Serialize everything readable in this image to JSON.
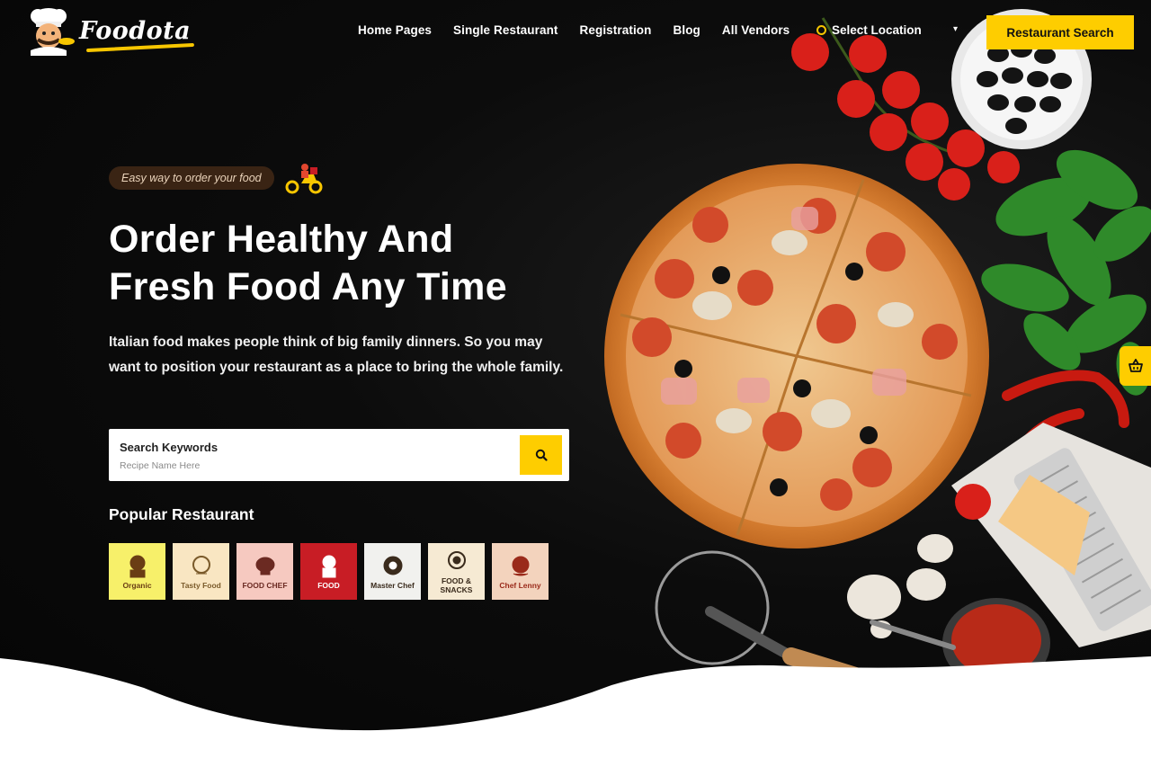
{
  "brand": {
    "name": "Foodota"
  },
  "nav": {
    "items": [
      {
        "label": "Home Pages"
      },
      {
        "label": "Single Restaurant"
      },
      {
        "label": "Registration"
      },
      {
        "label": "Blog"
      },
      {
        "label": "All Vendors"
      }
    ],
    "location_label": "Select Location",
    "cta_label": "Restaurant Search"
  },
  "hero": {
    "badge": "Easy way to order your food",
    "headline_line1": "Order Healthy And",
    "headline_line2": "Fresh Food Any Time",
    "description": "Italian food makes people think of big family dinners. So you may want to position your restaurant as a place to bring the whole family."
  },
  "search": {
    "label": "Search Keywords",
    "placeholder": "Recipe Name Here"
  },
  "popular": {
    "title": "Popular Restaurant",
    "logos": [
      {
        "text": "Organic",
        "bg": "#f7f06a",
        "fg": "#6a3d14"
      },
      {
        "text": "Tasty Food",
        "bg": "#f9e6c2",
        "fg": "#7a5a2a"
      },
      {
        "text": "FOOD CHEF",
        "bg": "#f6c9c0",
        "fg": "#6b2a22"
      },
      {
        "text": "FOOD",
        "bg": "#c81d25",
        "fg": "#ffffff"
      },
      {
        "text": "Master Chef",
        "bg": "#f1f1ee",
        "fg": "#3a2b1c"
      },
      {
        "text": "FOOD & SNACKS",
        "bg": "#f6ead3",
        "fg": "#3a2b1c"
      },
      {
        "text": "Chef Lenny",
        "bg": "#f3d3bd",
        "fg": "#9a2a1a"
      }
    ]
  },
  "colors": {
    "accent": "#fecd00",
    "background": "#0a0a0a"
  },
  "icons": {
    "search": "search-icon",
    "cart": "cart-icon",
    "location": "location-pin-icon"
  }
}
